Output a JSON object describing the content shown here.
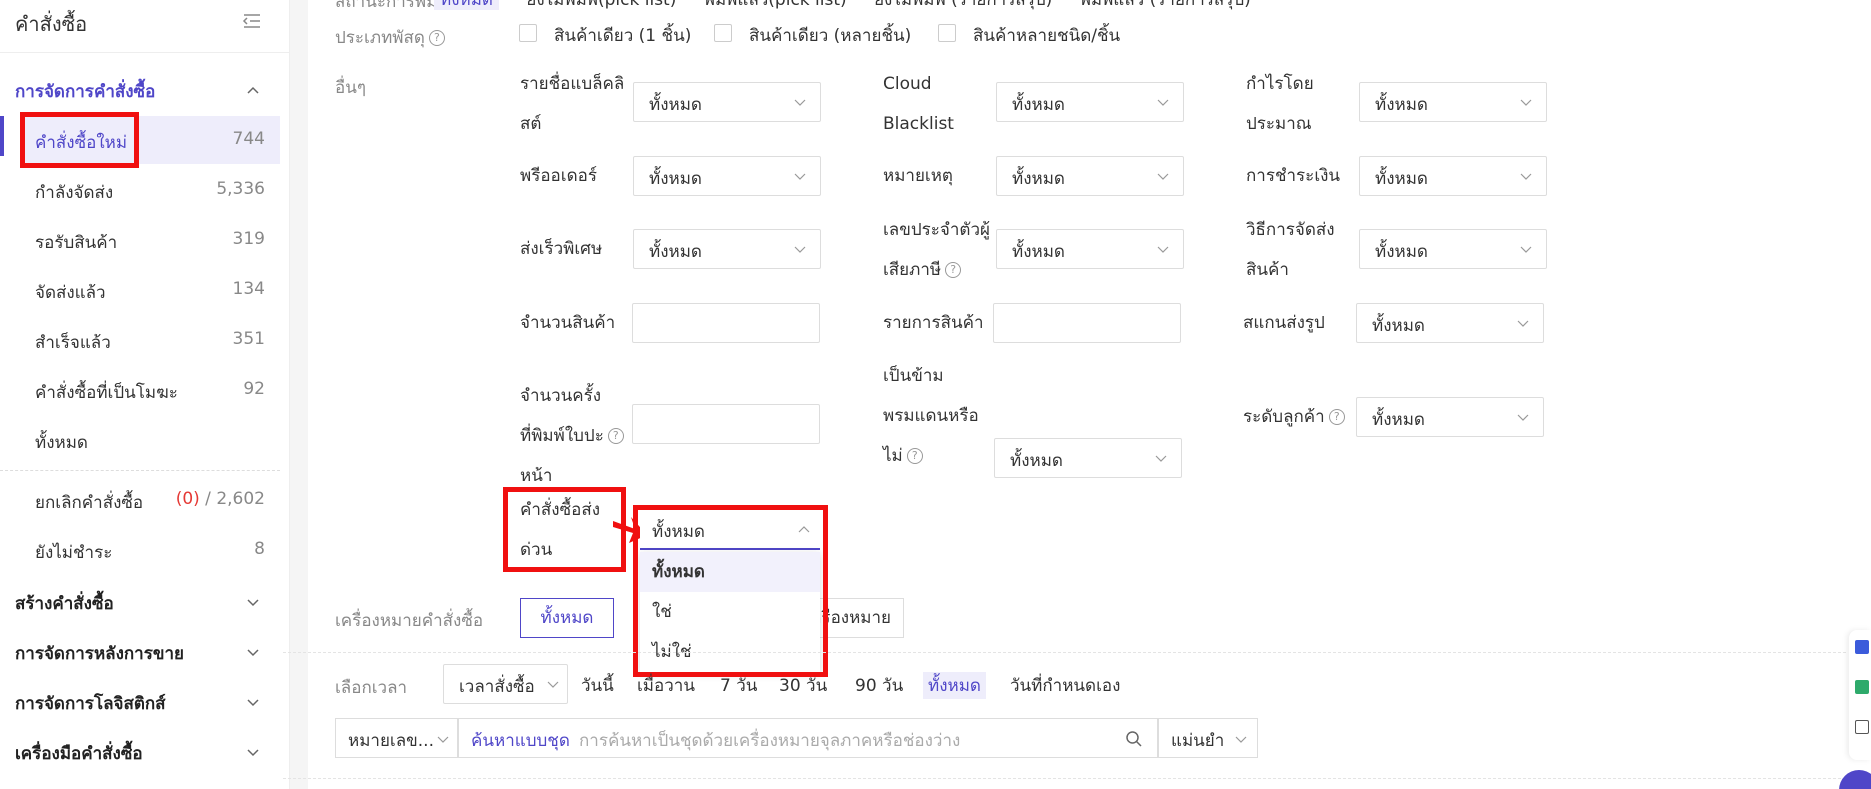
{
  "sidebar": {
    "title": "คำสั่งซื้อ",
    "section_manage": "การจัดการคำสั่งซื้อ",
    "items": [
      {
        "label": "คำสั่งซื้อใหม่",
        "count": "744"
      },
      {
        "label": "กำลังจัดส่ง",
        "count": "5,336"
      },
      {
        "label": "รอรับสินค้า",
        "count": "319"
      },
      {
        "label": "จัดส่งแล้ว",
        "count": "134"
      },
      {
        "label": "สำเร็จแล้ว",
        "count": "351"
      },
      {
        "label": "คำสั่งซื้อที่เป็นโมฆะ",
        "count": "92"
      },
      {
        "label": "ทั้งหมด",
        "count": ""
      }
    ],
    "cancel": {
      "label": "ยกเลิกคำสั่งซื้อ",
      "red": "(0)",
      "sep": " / ",
      "total": "2,602"
    },
    "unpaid": {
      "label": "ยังไม่ชำระ",
      "count": "8"
    },
    "sections": [
      "สร้างคำสั่งซื้อ",
      "การจัดการหลังการขาย",
      "การจัดการโลจิสติกส์",
      "เครื่องมือคำสั่งซื้อ"
    ]
  },
  "filters": {
    "print_status_label": "สถานะการพิมพ์",
    "print_tabs": [
      "ทั้งหมด",
      "ยังไม่พิมพ์(pick list)",
      "พิมพ์แล้ว(pick list)",
      "ยังไม่พิมพ์ (รายการสรุป)",
      "พิมพ์แล้ว (รายการสรุป)"
    ],
    "parcel_type_label": "ประเภทพัสดุ",
    "parcel_types": [
      "สินค้าเดียว (1 ชิ้น)",
      "สินค้าเดียว (หลายชิ้น)",
      "สินค้าหลายชนิด/ชิ้น"
    ],
    "other_label": "อื่นๆ",
    "all": "ทั้งหมด",
    "f1": [
      "รายชื่อแบล็คลิ",
      "สต์"
    ],
    "f2": [
      "Cloud",
      "Blacklist"
    ],
    "f3": [
      "กำไรโดย",
      "ประมาณ"
    ],
    "f4": "พรีออเดอร์",
    "f5": "หมายเหตุ",
    "f6": "การชำระเงิน",
    "f7": "ส่งเร็วพิเศษ",
    "f8": [
      "เลขประจำตัวผู้",
      "เสียภาษี"
    ],
    "f9": [
      "วิธีการจัดส่ง",
      "สินค้า"
    ],
    "f10": "จำนวนสินค้า",
    "f11": "รายการสินค้า",
    "f12": "สแกนส่งรูป",
    "f13": [
      "จำนวนครั้ง",
      "ที่พิมพ์ใบปะ",
      "หน้า"
    ],
    "f14": [
      "เป็นข้าม",
      "พรมแดนหรือ",
      "ไม่"
    ],
    "f15": "ระดับลูกค้า",
    "f16": [
      "คำสั่งซื้อส่ง",
      "ด่วน"
    ]
  },
  "dropdown": {
    "value": "ทั้งหมด",
    "options": [
      "ทั้งหมด",
      "ใช่",
      "ไม่ใช่"
    ]
  },
  "order_mark": {
    "label": "เครื่องหมายคำสั่งซื้อ",
    "all": "ทั้งหมด",
    "last": "ครื่องหมาย"
  },
  "time": {
    "label": "เลือกเวลา",
    "type": "เวลาสั่งซื้อ",
    "options": [
      "วันนี้",
      "เมื่อวาน",
      "7 วัน",
      "30 วัน",
      "90 วัน",
      "ทั้งหมด",
      "วันที่กำหนดเอง"
    ]
  },
  "search": {
    "field": "หมายเลข...",
    "mode": "ค้นหาแบบชุด",
    "placeholder": "การค้นหาเป็นชุดด้วยเครื่องหมายจุลภาคหรือช่องว่าง",
    "match": "แม่นยำ"
  },
  "colors": {
    "accent": "#4f46c8",
    "highlight": "#f01010"
  }
}
